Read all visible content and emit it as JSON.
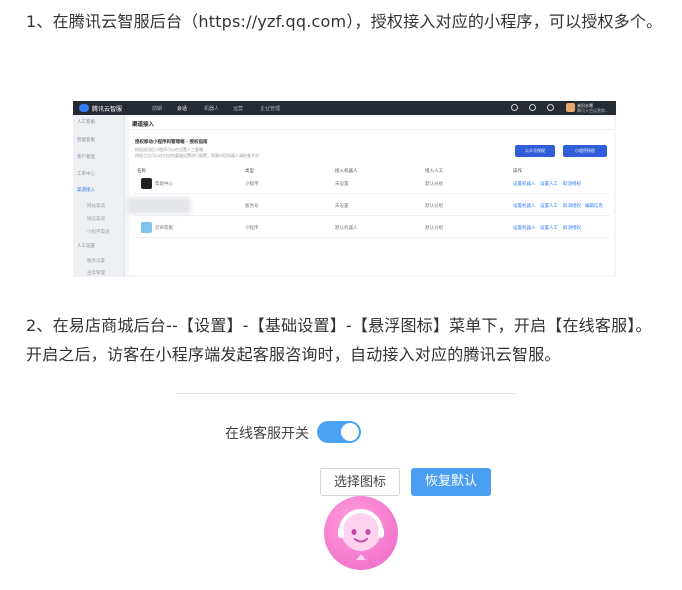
{
  "paragraph1": "1、在腾讯云智服后台（https://yzf.qq.com），授权接入对应的小程序，可以授权多个。",
  "paragraph2": "2、在易店商城后台--【设置】-【基础设置】-【悬浮图标】菜单下，开启【在线客服】。开启之后，访客在小程序端发起客服咨询时，自动接入对应的腾讯云智服。",
  "screenshot1": {
    "brand": "腾讯云智服",
    "nav": [
      "前期",
      "会话",
      "机器人",
      "运营",
      "企业管理"
    ],
    "nav_active_index": 1,
    "user_name": "未识水嗯",
    "user_sub": "腾讯天空运营商...",
    "sidebar": [
      "人工客服",
      "智能客服",
      "客户管理",
      "工单中心",
      "渠道接入",
      "网站渠道",
      "微信渠道",
      "小程序渠道",
      "人工设置",
      "服务设置",
      "坐席管理"
    ],
    "page_title": "渠道接入",
    "channel_title": "授权移动小程序和管理端 - 授权指南",
    "notes": [
      "授权成功后小程序可以在设置人工客服",
      "授权之后可以在对应的渠道设置进行配置，如果对话机器人请检查开启"
    ],
    "buttons": [
      "公众号授权",
      "小程序授权"
    ],
    "columns": [
      "名称",
      "类型",
      "接入机器人",
      "接入人工",
      "操作"
    ],
    "rows": [
      {
        "name": "帮助中心",
        "type": "小程序",
        "bot": "未设置",
        "human": "默认分组",
        "ops": [
          "设置机器人",
          "设置人工",
          "取消授权"
        ]
      },
      {
        "name": "",
        "type": "服务号",
        "bot": "未设置",
        "human": "默认分组",
        "ops": [
          "设置机器人",
          "设置人工",
          "取消授权",
          "编辑信息"
        ]
      },
      {
        "name": "云商客服",
        "type": "小程序",
        "bot": "默认机器人",
        "human": "默认分组",
        "ops": [
          "设置机器人",
          "设置人工",
          "取消授权"
        ]
      }
    ]
  },
  "screenshot2": {
    "toggle_label": "在线客服开关",
    "toggle_on": true,
    "btn_choose": "选择图标",
    "btn_restore": "恢复默认",
    "colors": {
      "toggle": "#4aa3f2",
      "primary": "#4a9ff0",
      "bubble": "#f67ed0"
    }
  }
}
